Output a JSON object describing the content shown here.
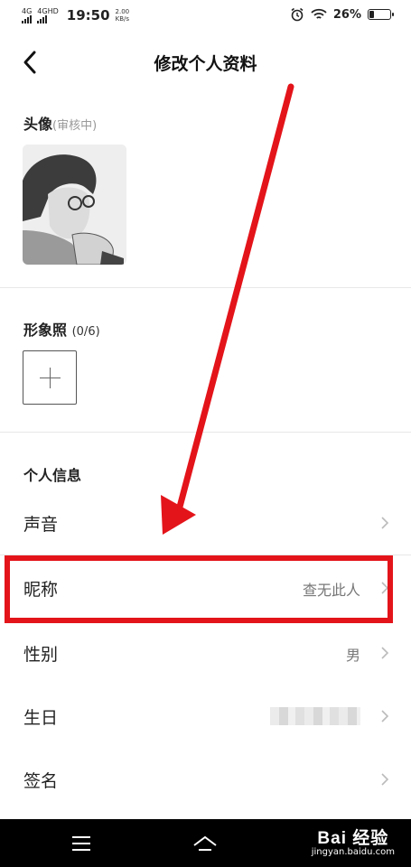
{
  "status_bar": {
    "signal1": "4G",
    "signal2": "4GHD",
    "time": "19:50",
    "speed_value": "2.00",
    "speed_unit": "KB/s",
    "battery_percent": "26%",
    "battery_level": 0.26
  },
  "header": {
    "title": "修改个人资料"
  },
  "avatar_section": {
    "label": "头像",
    "status": "(审核中)"
  },
  "photos_section": {
    "label": "形象照",
    "count": "(0/6)"
  },
  "info_section": {
    "label": "个人信息",
    "rows": [
      {
        "label": "声音",
        "value": ""
      },
      {
        "label": "昵称",
        "value": "查无此人"
      },
      {
        "label": "性别",
        "value": "男"
      },
      {
        "label": "生日",
        "value": ""
      },
      {
        "label": "签名",
        "value": ""
      }
    ]
  },
  "watermark": {
    "main": "Bai 经验",
    "sub": "jingyan.baidu.com"
  },
  "colors": {
    "annotation_red": "#e3141a",
    "nav_bar": "#000000"
  }
}
